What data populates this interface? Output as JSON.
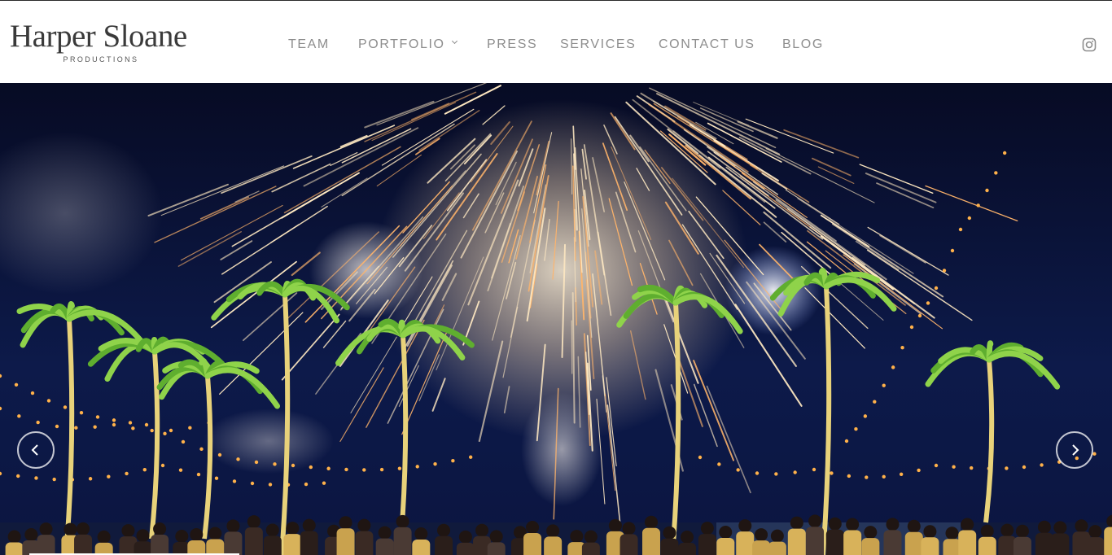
{
  "brand": {
    "name": "Harper Sloane",
    "tagline": "PRODUCTIONS"
  },
  "nav": {
    "items": [
      {
        "label": "TEAM"
      },
      {
        "label": "PORTFOLIO",
        "has_dropdown": true
      },
      {
        "label": "PRESS"
      },
      {
        "label": "SERVICES"
      },
      {
        "label": "CONTACT US"
      },
      {
        "label": "BLOG"
      }
    ],
    "social_icon": "instagram-icon"
  },
  "hero": {
    "image_subject": "fireworks over palm trees at a night beach event",
    "prev_icon": "chevron-left-icon",
    "next_icon": "chevron-right-icon",
    "colors": {
      "sky": "#0b1236",
      "sparks": "#ffe6b8",
      "palms": "#6fbf3a",
      "lights": "#ffb14a"
    }
  }
}
